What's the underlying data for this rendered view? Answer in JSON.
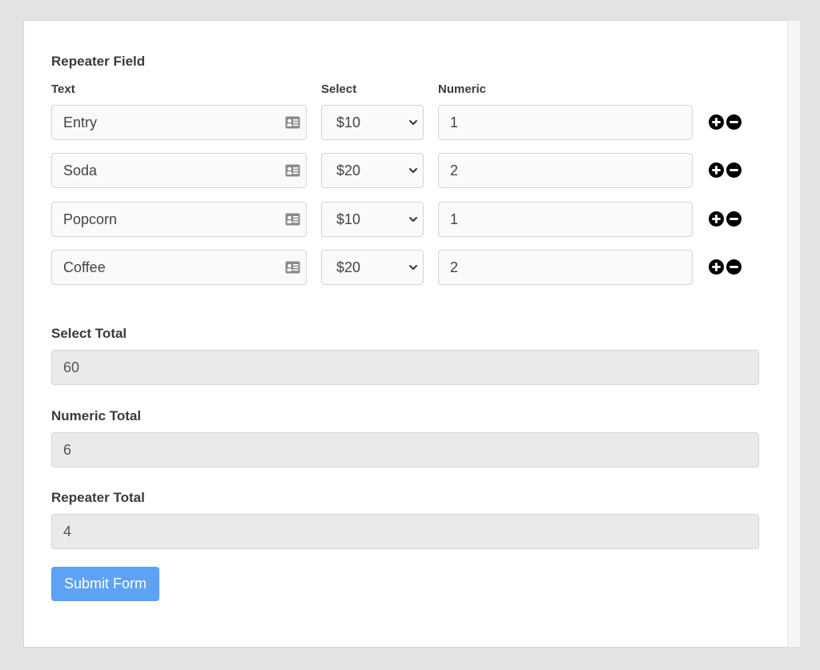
{
  "form": {
    "repeater_label": "Repeater Field",
    "columns": {
      "text": "Text",
      "select": "Select",
      "numeric": "Numeric"
    },
    "rows": [
      {
        "text": "Entry",
        "select": "$10",
        "numeric": "1"
      },
      {
        "text": "Soda",
        "select": "$20",
        "numeric": "2"
      },
      {
        "text": "Popcorn",
        "select": "$10",
        "numeric": "1"
      },
      {
        "text": "Coffee",
        "select": "$20",
        "numeric": "2"
      }
    ],
    "select_total": {
      "label": "Select Total",
      "value": "60"
    },
    "numeric_total": {
      "label": "Numeric Total",
      "value": "6"
    },
    "repeater_total": {
      "label": "Repeater Total",
      "value": "4"
    },
    "submit_label": "Submit Form"
  },
  "icons": {
    "text_field": "contact-card-icon",
    "select": "chevron-down-icon",
    "add": "plus-circle-icon",
    "remove": "minus-circle-icon"
  },
  "colors": {
    "submit_button": "#5ea2f5",
    "page_background": "#e3e3e3"
  }
}
